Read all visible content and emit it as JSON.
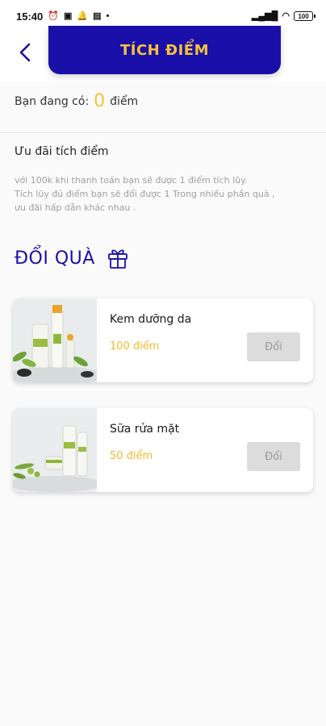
{
  "status_bar": {
    "time": "15:40",
    "battery": "100"
  },
  "header": {
    "title": "TÍCH ĐIỂM"
  },
  "points": {
    "label": "Bạn đang có:",
    "value": "0",
    "unit": "điểm"
  },
  "offer": {
    "title": "Ưu đãi tích điểm",
    "line1": "với 100k khi thanh toán bạn sẽ được 1 điểm tích lũy.",
    "line2": "Tích lũy đủ điểm bạn sẽ đổi được 1 Trong  nhiều phần quà ,",
    "line3": "ưu đãi hấp dẫn khác nhau ."
  },
  "gifts": {
    "title": "ĐỔI QUÀ",
    "items": [
      {
        "name": "Kem dưỡng da",
        "points": "100 điểm",
        "button": "Đổi"
      },
      {
        "name": "Sữa rửa mặt",
        "points": "50 điểm",
        "button": "Đổi"
      }
    ]
  },
  "colors": {
    "primary": "#1a0fa8",
    "accent": "#f5c23c",
    "disabled_button": "#dcdcdc"
  }
}
